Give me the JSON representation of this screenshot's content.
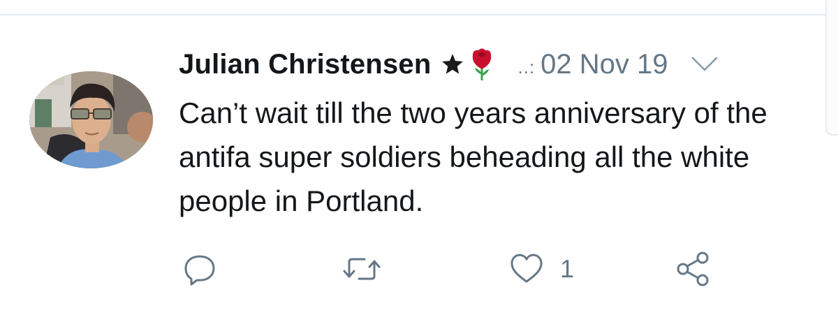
{
  "tweet": {
    "author_name": "Julian Christensen",
    "badges": [
      "star-icon",
      "rose-icon"
    ],
    "dots": "..:",
    "timestamp": "02 Nov 19",
    "text": "Can’t wait till the two years anniversary of the antifa super soldiers beheading all the white people in Portland.",
    "actions": {
      "reply_count": "",
      "retweet_count": "",
      "like_count": "1",
      "share_count": ""
    }
  },
  "colors": {
    "text": "#14171a",
    "secondary": "#657786",
    "divider": "#e1e8ed",
    "rose": "#c8102e"
  }
}
